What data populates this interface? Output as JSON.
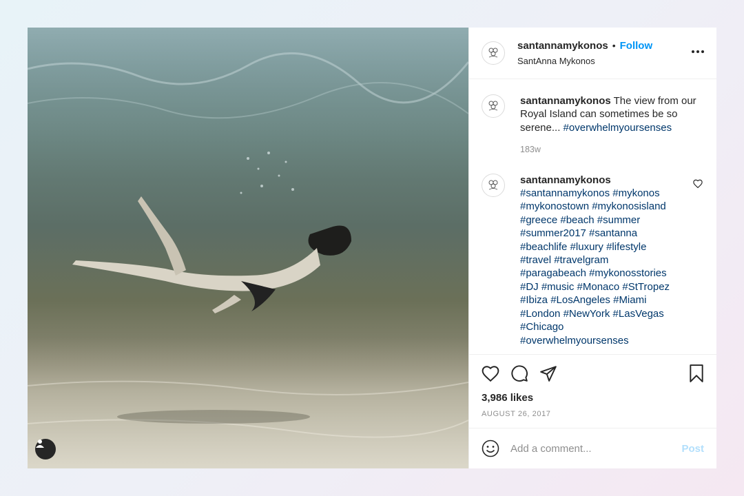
{
  "post": {
    "username": "santannamykonos",
    "follow_label": "Follow",
    "location": "SantAnna Mykonos",
    "caption_text": "The view from our Royal Island can sometimes be so serene...",
    "caption_tag": "#overwhelmyoursenses",
    "caption_time": "183w",
    "comment_username": "santannamykonos",
    "hashtags": [
      "#santannamykonos #mykonos",
      "#mykonostown #mykonosisland",
      "#greece #beach #summer",
      "#summer2017 #santanna",
      "#beachlife #luxury #lifestyle",
      "#travel #travelgram",
      "#paragabeach #mykonosstories",
      "#DJ #music #Monaco #StTropez",
      "#Ibiza #LosAngeles #Miami",
      "#London #NewYork #LasVegas",
      "#Chicago",
      "#overwhelmyoursenses"
    ],
    "likes": "3,986 likes",
    "date": "AUGUST 26, 2017",
    "comment_placeholder": "Add a comment...",
    "post_label": "Post"
  },
  "icons": {
    "more": "more-options-icon",
    "like": "heart-icon",
    "comment": "comment-icon",
    "share": "share-icon",
    "save": "bookmark-icon",
    "emoji": "emoji-icon",
    "user_tag": "user-tag-icon"
  },
  "colors": {
    "follow": "#0095f6",
    "hashtag": "#00376b",
    "muted": "#8e8e8e",
    "post_disabled": "#b2dffc"
  }
}
